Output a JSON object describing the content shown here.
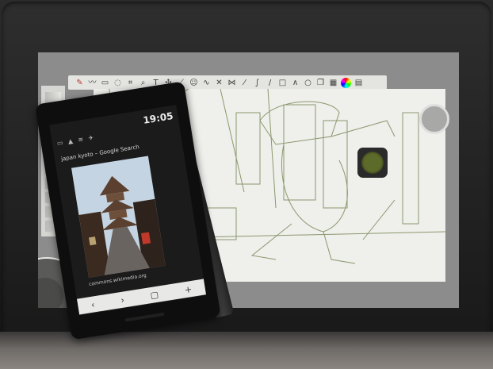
{
  "phone": {
    "time": "19:05",
    "url_text": "japan kyoto – Google Search",
    "caption": "commons.wikimedia.org",
    "nav": [
      "‹",
      "›",
      "▢",
      "+"
    ]
  },
  "colors": {
    "screen_bg": "#8c8c8c",
    "canvas": "#efefeb",
    "sketch_line": "#7a8a5a",
    "puck": "#5c6a2a"
  },
  "icons": [
    "brush-icon",
    "lasso-icon",
    "crop-icon",
    "zoom-icon",
    "text-icon",
    "move-icon",
    "eraser-icon",
    "color-wheel-icon"
  ]
}
